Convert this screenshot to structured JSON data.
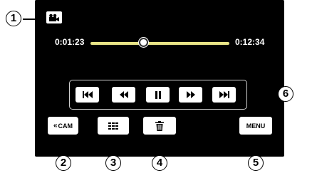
{
  "player": {
    "elapsed_time": "0:01:23",
    "total_time": "0:12:34",
    "progress": 0.38
  },
  "controls": {
    "skip_back_icon": "skip-to-start-icon",
    "rewind_icon": "rewind-icon",
    "pause_icon": "pause-icon",
    "fast_forward_icon": "fast-forward-icon",
    "skip_forward_icon": "skip-to-end-icon"
  },
  "buttons": {
    "cam_label": "CAM",
    "menu_label": "MENU"
  },
  "callouts": [
    "1",
    "2",
    "3",
    "4",
    "5",
    "6"
  ],
  "colors": {
    "screen_bg": "#000000",
    "progress_track": "#e8e486"
  }
}
